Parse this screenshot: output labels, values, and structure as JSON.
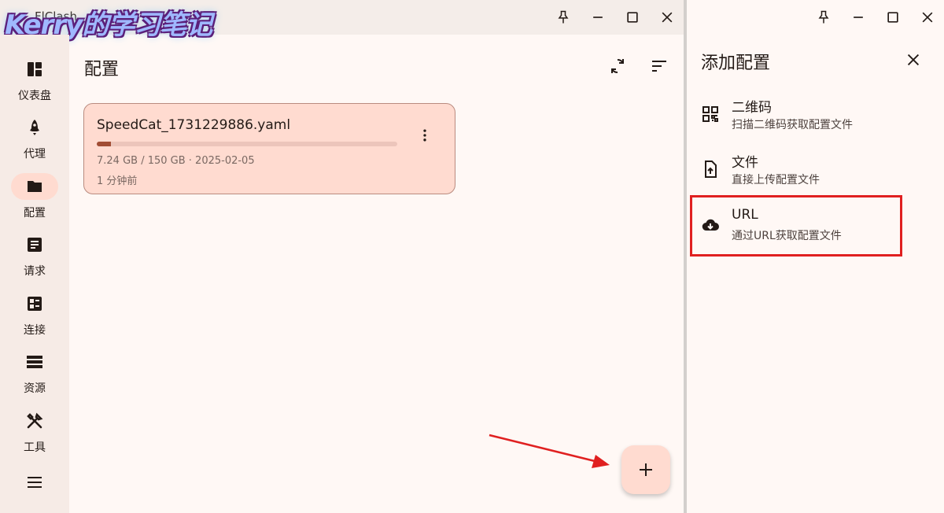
{
  "left_window": {
    "title": "FlClash",
    "watermark": "Kerry的学习笔记",
    "page_title": "配置",
    "header_icons": [
      "sync-icon",
      "sort-icon"
    ],
    "sidebar": [
      {
        "label": "仪表盘",
        "icon": "dashboard-icon",
        "active": false
      },
      {
        "label": "代理",
        "icon": "rocket-icon",
        "active": false
      },
      {
        "label": "配置",
        "icon": "folder-icon",
        "active": true
      },
      {
        "label": "请求",
        "icon": "article-icon",
        "active": false
      },
      {
        "label": "连接",
        "icon": "connections-icon",
        "active": false
      },
      {
        "label": "资源",
        "icon": "storage-icon",
        "active": false
      },
      {
        "label": "工具",
        "icon": "tools-icon",
        "active": false
      },
      {
        "label": "",
        "icon": "menu-icon",
        "active": false
      }
    ],
    "profile_card": {
      "name": "SpeedCat_1731229886.yaml",
      "usage": "7.24 GB / 150 GB · 2025-02-05",
      "updated": "1 分钟前",
      "used_fraction": 0.048
    },
    "fab_icon": "plus-icon"
  },
  "right_panel": {
    "title": "添加配置",
    "options": [
      {
        "title": "二维码",
        "subtitle": "扫描二维码获取配置文件",
        "icon": "qr-code-icon"
      },
      {
        "title": "文件",
        "subtitle": "直接上传配置文件",
        "icon": "file-upload-icon"
      },
      {
        "title": "URL",
        "subtitle": "通过URL获取配置文件",
        "icon": "cloud-download-icon",
        "highlighted": true
      }
    ]
  },
  "colors": {
    "accent": "#a14d34",
    "card_bg": "#ffdbd0",
    "annotation": "#e02020"
  }
}
